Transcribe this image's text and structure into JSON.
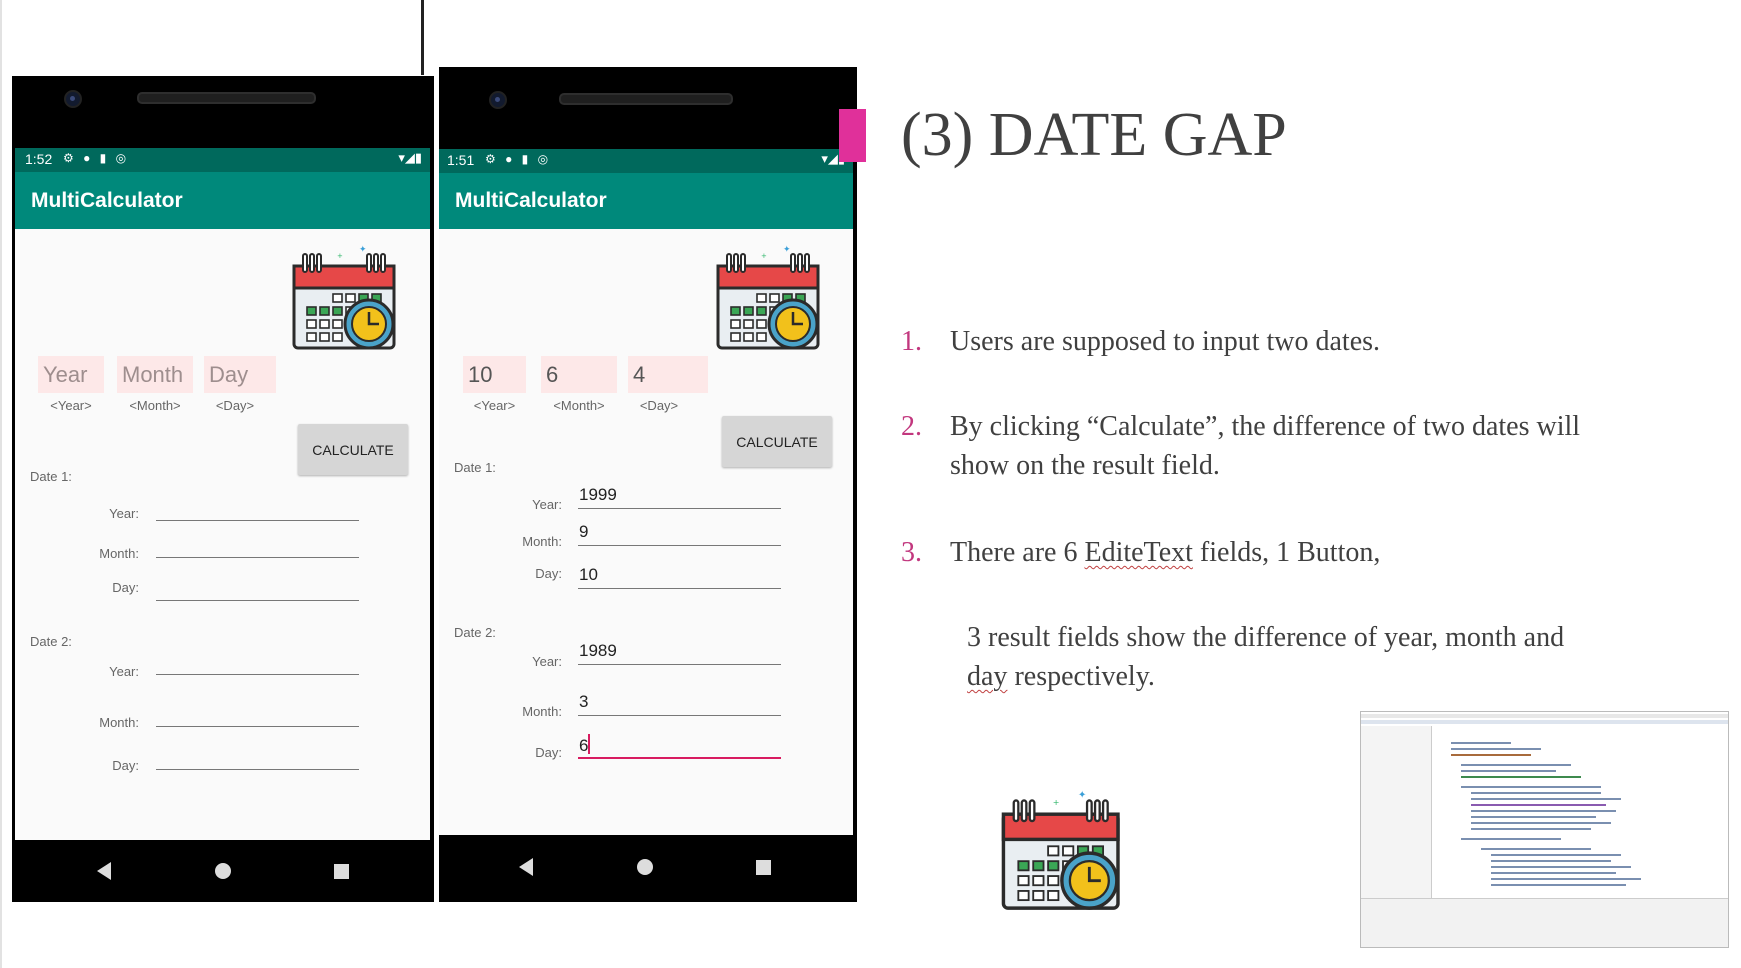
{
  "phone1": {
    "time": "1:52",
    "app_title": "MultiCalculator",
    "inputs": [
      {
        "text": "Year",
        "sub": "<Year>"
      },
      {
        "text": "Month",
        "sub": "<Month>"
      },
      {
        "text": "Day",
        "sub": "<Day>"
      }
    ],
    "button": "CALCULATE",
    "date1_label": "Date 1:",
    "date2_label": "Date 2:",
    "row_labels": {
      "year": "Year:",
      "month": "Month:",
      "day": "Day:"
    },
    "date1": {
      "year": "",
      "month": "",
      "day": ""
    },
    "date2": {
      "year": "",
      "month": "",
      "day": ""
    }
  },
  "phone2": {
    "time": "1:51",
    "app_title": "MultiCalculator",
    "inputs": [
      {
        "text": "10",
        "sub": "<Year>"
      },
      {
        "text": "6",
        "sub": "<Month>"
      },
      {
        "text": "4",
        "sub": "<Day>"
      }
    ],
    "button": "CALCULATE",
    "date1_label": "Date 1:",
    "date2_label": "Date 2:",
    "row_labels": {
      "year": "Year:",
      "month": "Month:",
      "day": "Day:"
    },
    "date1": {
      "year": "1999",
      "month": "9",
      "day": "10"
    },
    "date2": {
      "year": "1989",
      "month": "3",
      "day": "6"
    }
  },
  "slide": {
    "title": "(3) DATE GAP",
    "items": [
      {
        "num": "1.",
        "text": "Users are supposed to input two dates."
      },
      {
        "num": "2.",
        "line1": "By clicking “Calculate”, the difference of  two dates will",
        "line2": "show on the result field."
      },
      {
        "num": "3.",
        "pre": "There are 6 ",
        "squig": "EditeText",
        "post": " fields, 1 Button,"
      }
    ],
    "sub_line1": "3 result fields show the difference of  year, month and",
    "sub_line2_squig": "day",
    "sub_line2_rest": " respectively."
  },
  "colors": {
    "appbar": "#00897b",
    "statusbar": "#00695c",
    "field_bg": "#fde8e8",
    "accent": "#c2377e",
    "underline_active": "#d81b60"
  },
  "icons": {
    "calendar": "calendar-clock-icon"
  }
}
